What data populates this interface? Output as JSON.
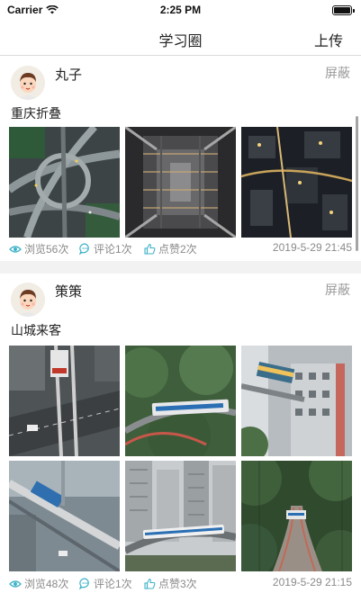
{
  "status_bar": {
    "carrier": "Carrier",
    "time": "2:25 PM"
  },
  "nav": {
    "title": "学习圈",
    "upload_label": "上传"
  },
  "posts": [
    {
      "username": "丸子",
      "block_label": "屏蔽",
      "text": "重庆折叠",
      "views": "浏览56次",
      "comments": "评论1次",
      "likes": "点赞2次",
      "date": "2019-5-29 21:45"
    },
    {
      "username": "策策",
      "block_label": "屏蔽",
      "text": "山城来客",
      "views": "浏览48次",
      "comments": "评论1次",
      "likes": "点赞3次",
      "date": "2019-5-29 21:15"
    }
  ],
  "colors": {
    "meta_icon": "#3fb3c8",
    "like_icon": "#3fb3c8",
    "muted_text": "#9a9a9a"
  }
}
